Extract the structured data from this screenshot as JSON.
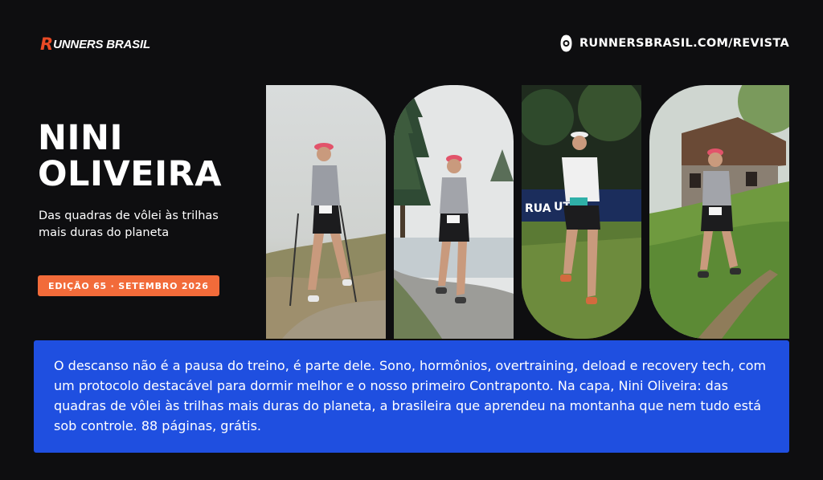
{
  "header": {
    "logo_mark": "R",
    "logo_text": "UNNERS BRASIL",
    "url_icon": "magazine-badge-icon",
    "url": "RUNNERSBRASIL.COM/REVISTA"
  },
  "cover": {
    "title_line1": "NINI",
    "title_line2": "OLIVEIRA",
    "subtitle": "Das quadras de vôlei às trilhas mais duras do planeta",
    "edition": "EDIÇÃO 65 · SETEMBRO 2026"
  },
  "photos": [
    {
      "scene": "runner with poles on misty trail"
    },
    {
      "scene": "runner by lake with pine trees"
    },
    {
      "scene": "runner near UTMB finish banner"
    },
    {
      "scene": "runner on grassy slope by chalet"
    }
  ],
  "description": "O descanso não é a pausa do treino, é parte dele. Sono, hormônios, overtraining, deload e recovery tech, com um protocolo destacável para dormir melhor e o nosso primeiro Contraponto. Na capa, Nini Oliveira: das quadras de vôlei às trilhas mais duras do planeta, a brasileira que aprendeu na montanha que nem tudo está sob controle. 88 páginas, grátis.",
  "colors": {
    "background": "#0e0e10",
    "brand_orange": "#e94a25",
    "badge": "#f26b3a",
    "panel_blue": "#1f4fe0"
  }
}
